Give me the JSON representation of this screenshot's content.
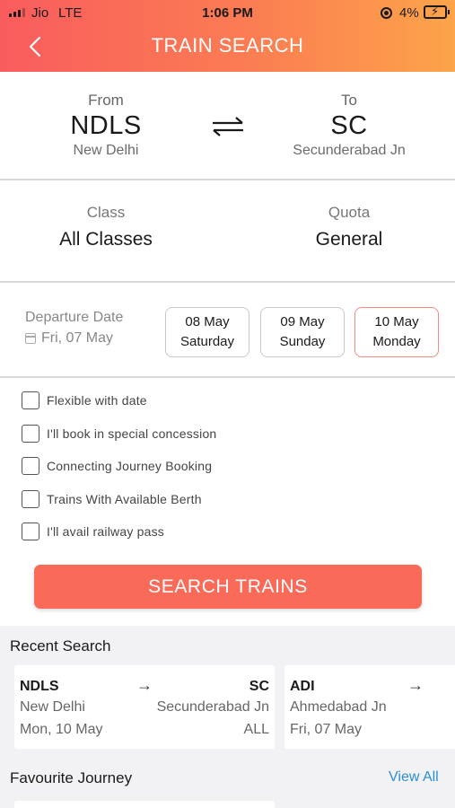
{
  "status_bar": {
    "carrier": "Jio",
    "network": "LTE",
    "time": "1:06 PM",
    "battery": "4%"
  },
  "header": {
    "title": "TRAIN SEARCH",
    "back_icon": "chevron-left-icon"
  },
  "route": {
    "from_label": "From",
    "from_code": "NDLS",
    "from_name": "New Delhi",
    "to_label": "To",
    "to_code": "SC",
    "to_name": "Secunderabad Jn",
    "swap_icon": "swap-arrows-icon"
  },
  "class": {
    "label": "Class",
    "value": "All Classes"
  },
  "quota": {
    "label": "Quota",
    "value": "General"
  },
  "departure": {
    "label": "Departure Date",
    "date": "Fri, 07 May",
    "chips": [
      {
        "date": "08 May",
        "day": "Saturday"
      },
      {
        "date": "09 May",
        "day": "Sunday"
      },
      {
        "date": "10 May",
        "day": "Monday"
      }
    ]
  },
  "options": [
    "Flexible with date",
    "I'll book in special concession",
    "Connecting Journey Booking",
    "Trains With Available Berth",
    "I'll avail railway pass"
  ],
  "search_button": "SEARCH TRAINS",
  "recent": {
    "title": "Recent Search",
    "cards": [
      {
        "from_code": "NDLS",
        "to_code": "SC",
        "from_name": "New Delhi",
        "to_name": "Secunderabad Jn",
        "date": "Mon, 10 May",
        "class": "ALL"
      },
      {
        "from_code": "ADI",
        "from_name": "Ahmedabad Jn",
        "date": "Fri, 07 May"
      }
    ]
  },
  "favourite": {
    "title": "Favourite Journey",
    "view_all": "View All"
  },
  "colors": {
    "accent": "#f96a58",
    "header_start": "#f95c5e",
    "header_end": "#fca44a",
    "link": "#2a8fd6"
  }
}
